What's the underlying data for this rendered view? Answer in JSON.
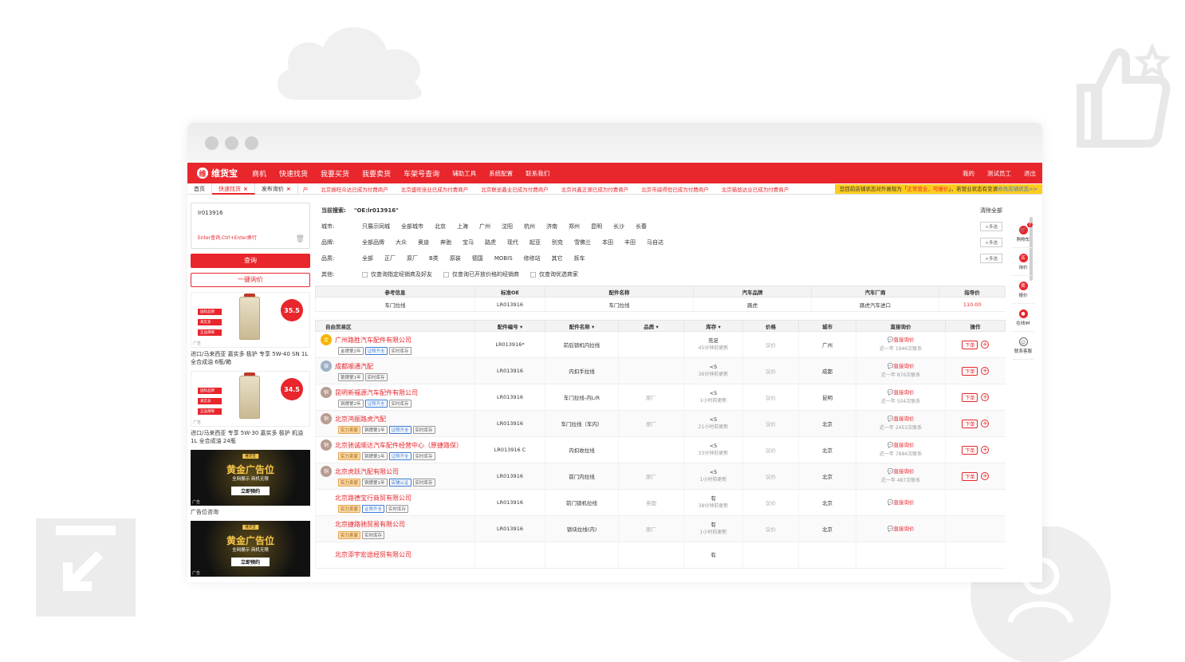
{
  "nav": {
    "logo_text": "维货宝",
    "items": [
      "商机",
      "快速找货",
      "我要买货",
      "我要卖货",
      "车架号查询"
    ],
    "small_items": [
      "辅助工具",
      "系统配置",
      "联系我们"
    ],
    "right": [
      "我的",
      "测试员工",
      "退出"
    ]
  },
  "tabs": {
    "items": [
      "首页",
      "快速找货",
      "发布询价"
    ],
    "ticker": [
      "户",
      "北京振旺众达已成为付费商户",
      "北京盛旺佳业已成为付费商户",
      "北京联途鑫业已成为付费商户",
      "北京共鑫正源已成为付费商户",
      "北京市威得恒已成为付费商户",
      "北京猫悠达业已成为付费商户"
    ],
    "notice_a": "您目前店铺状态对外展现为「",
    "notice_em": "正常营业，可报价",
    "notice_b": "」，若营业状态有变请",
    "notice_link": "修改店铺状态>>"
  },
  "left": {
    "search_value": "lr013916",
    "hint": "Enter查询,Ctrl+Enter换行",
    "query_btn": "查询",
    "oneclick_btn": "一键询价",
    "ads": [
      {
        "tags": [
          "国际品牌",
          "真实多",
          "正品保障"
        ],
        "price": "35.5",
        "ad_label": "广告",
        "title": "进口/马来西亚 嘉实多 极护 专享 5W-40 SN 1L 全合成油 6瓶/箱"
      },
      {
        "tags": [
          "国际品牌",
          "真实多",
          "正品保障"
        ],
        "price": "34.5",
        "ad_label": "广告",
        "title": "进口/马来西亚 专享 5W-30 嘉实多 极护 机油 1L 全合成油 24瓶"
      }
    ],
    "gold_ads": [
      {
        "top": "维货宝",
        "big": "黄金广告位",
        "sub": "全网展示  商机无限",
        "btn": "立即预约",
        "ad_label": "广告",
        "caption": "广告位咨询"
      },
      {
        "top": "维货宝",
        "big": "黄金广告位",
        "sub": "全网展示  商机无限",
        "btn": "立即预约",
        "ad_label": "广告"
      }
    ]
  },
  "filters": {
    "current_label": "当前搜索:",
    "current_value": "\"OE:lr013916\"",
    "clear_all": "清除全部",
    "city_label": "城市:",
    "cities": [
      "只展示同城",
      "全部城市",
      "北京",
      "上海",
      "广州",
      "沈阳",
      "杭州",
      "济南",
      "郑州",
      "昆明",
      "长沙",
      "长春"
    ],
    "brand_label": "品牌:",
    "brands": [
      "全部品牌",
      "大众",
      "奥迪",
      "奔驰",
      "宝马",
      "路虎",
      "现代",
      "起亚",
      "别克",
      "雪佛兰",
      "本田",
      "丰田",
      "马自达"
    ],
    "quality_label": "品质:",
    "qualities": [
      "全部",
      "正厂",
      "原厂",
      "B类",
      "原装",
      "德国",
      "MOBIS",
      "修修站",
      "其它",
      "拆车"
    ],
    "other_label": "其他:",
    "others": [
      "仅查询指定经销商及好友",
      "仅查询已开放价格的经销商",
      "仅查询优选商家"
    ],
    "multi": "多选"
  },
  "ref_table": {
    "headers": [
      "参考信息",
      "标准OE",
      "配件名称",
      "汽车品牌",
      "汽车厂商",
      "指导价"
    ],
    "row": [
      "车门拉线",
      "LR013916",
      "车门拉线",
      "路虎",
      "路虎汽车进口",
      "110.00"
    ]
  },
  "table": {
    "headers": [
      "自由贸易区",
      "配件编号 ▾",
      "配件名称 ▾",
      "品质 ▾",
      "库存 ▾",
      "价格",
      "城市",
      "直接询价",
      "操作"
    ],
    "inquire": "直接询价",
    "order": "下单",
    "rows": [
      {
        "badge": "gold",
        "badge_text": "金",
        "name": "广州路胜汽车配件有限公司",
        "chips": [
          "金牌第2年",
          "证照齐全",
          "实时库存"
        ],
        "code": "LR013916*",
        "part": "前后锁机内拉线",
        "quality": "",
        "stock": "充足",
        "stock_sub": "45分钟前更新",
        "price": "议价",
        "city": "广州",
        "contact": "近一年 1946次联系",
        "op": true
      },
      {
        "badge": "gray",
        "badge_text": "银",
        "name": "成都顺通汽配",
        "chips": [
          "银牌第1年",
          "实时库存"
        ],
        "code": "LR013916",
        "part": "内扣手拉线",
        "quality": "",
        "stock": "<5",
        "stock_sub": "36分钟前更新",
        "price": "议价",
        "city": "成都",
        "contact": "近一年 876次联系",
        "op": true
      },
      {
        "badge": "brown",
        "badge_text": "铜",
        "name": "昆明新福源汽车配件有限公司",
        "chips": [
          "铜牌第2年",
          "证照齐全",
          "实时库存"
        ],
        "code": "LR013916",
        "part": "车门拉线-内L/R",
        "quality": "原厂",
        "stock": "<5",
        "stock_sub": "1小时前更新",
        "price": "议价",
        "city": "昆明",
        "contact": "近一年 504次联系",
        "op": true
      },
      {
        "badge": "brown",
        "badge_text": "铜",
        "name": "北京鸿振路虎汽配",
        "chips": [
          "实力卖家",
          "铜牌第1年",
          "证照齐全",
          "实时库存"
        ],
        "code": "LR013916",
        "part": "车门拉线（车内）",
        "quality": "原厂",
        "stock": "<5",
        "stock_sub": "21小时前更新",
        "price": "议价",
        "city": "北京",
        "contact": "近一年 2453次联系",
        "op": true
      },
      {
        "badge": "brown",
        "badge_text": "铜",
        "name": "北京驰诚顺达汽车配件经营中心（原捷路保）",
        "chips": [
          "实力卖家",
          "铜牌第1年",
          "证照齐全",
          "实时库存"
        ],
        "code": "LR013916 C",
        "part": "内扣收拉线",
        "quality": "",
        "stock": "<5",
        "stock_sub": "33分钟前更新",
        "price": "议价",
        "city": "北京",
        "contact": "近一年 7884次联系",
        "op": true
      },
      {
        "badge": "brown",
        "badge_text": "铜",
        "name": "北京虎跃汽配有限公司",
        "chips": [
          "实力卖家",
          "铜牌第1年",
          "店铺认证",
          "实时库存"
        ],
        "code": "LR013916",
        "part": "前门内拉线",
        "quality": "原厂",
        "stock": "<5",
        "stock_sub": "1小时前更新",
        "price": "议价",
        "city": "北京",
        "contact": "近一年 487次联系",
        "op": true
      },
      {
        "badge": "none",
        "badge_text": "",
        "name": "北京路德宝行商贸有限公司",
        "chips": [
          "实力卖家",
          "证照齐全",
          "实时库存"
        ],
        "code": "LR013916",
        "part": "前门锁机拉线",
        "quality": "英国",
        "stock": "有",
        "stock_sub": "38分钟前更新",
        "price": "议价",
        "city": "北京",
        "contact": "",
        "op": false
      },
      {
        "badge": "none",
        "badge_text": "",
        "name": "北京捷路驰贸易有限公司",
        "chips": [
          "实力卖家",
          "实时库存"
        ],
        "code": "LR013916",
        "part": "锁块拉线(内)",
        "quality": "原厂",
        "stock": "有",
        "stock_sub": "1小时前更新",
        "price": "议价",
        "city": "北京",
        "contact": "",
        "op": false
      },
      {
        "badge": "none",
        "badge_text": "",
        "name": "北京添宇宏途经贸有限公司",
        "chips": [],
        "code": "",
        "part": "",
        "quality": "",
        "stock": "有",
        "stock_sub": "",
        "price": "",
        "city": "",
        "contact": "",
        "op": false
      }
    ]
  },
  "sidebar": {
    "items": [
      {
        "label": "购物车",
        "icon": "cart-icon",
        "glyph": "🛒",
        "count": "7"
      },
      {
        "label": "询价",
        "icon": "inquiry-icon",
        "glyph": "买"
      },
      {
        "label": "报价",
        "icon": "quote-icon",
        "glyph": "卖"
      },
      {
        "label": "在线IM",
        "icon": "chat-icon",
        "glyph": "●"
      },
      {
        "label": "联系客服",
        "icon": "service-icon",
        "glyph": "☺"
      }
    ]
  },
  "colors": {
    "brand": "#e8262c",
    "notice": "#ffcc1d",
    "link": "#3a7bd5"
  }
}
